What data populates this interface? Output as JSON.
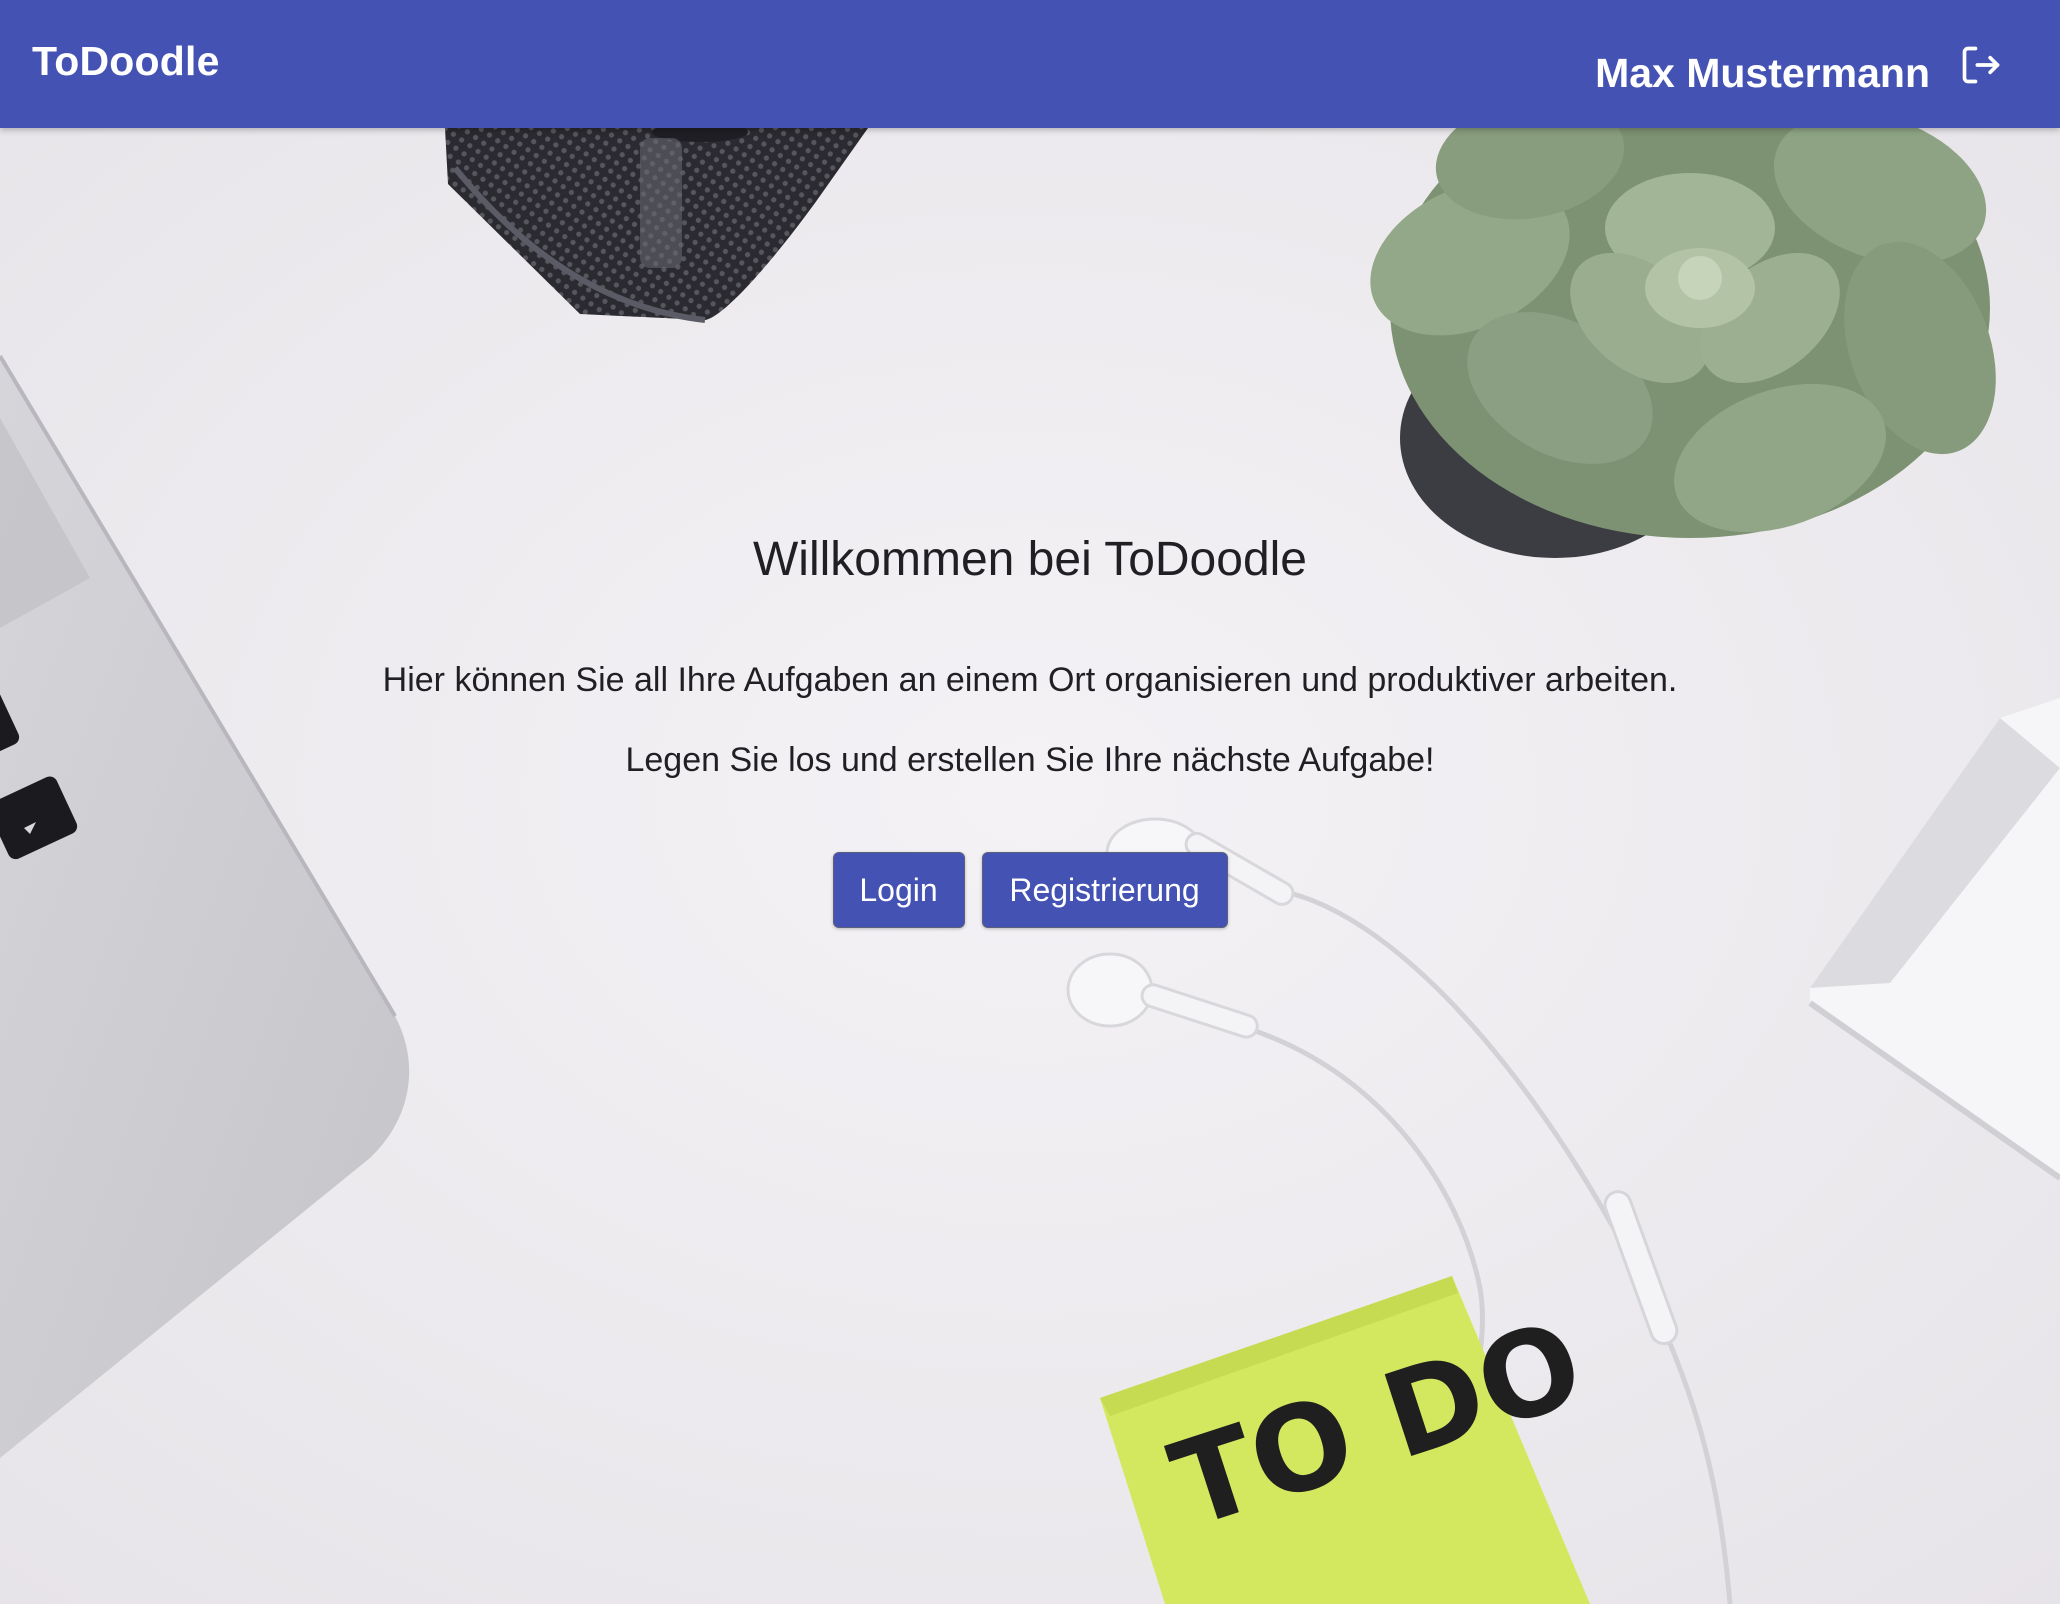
{
  "app": {
    "brand": "ToDoodle"
  },
  "header": {
    "user_name": "Max Mustermann",
    "logout_icon": "logout-icon"
  },
  "welcome": {
    "title": "Willkommen bei ToDoodle",
    "line1": "Hier können Sie all Ihre Aufgaben an einem Ort organisieren und produktiver arbeiten.",
    "line2": "Legen Sie los und erstellen Sie Ihre nächste Aufgabe!"
  },
  "actions": {
    "login_label": "Login",
    "register_label": "Registrierung"
  },
  "background": {
    "sticky_note_text": "TO DO"
  },
  "colors": {
    "primary": "#4352b3",
    "background": "#efedf0",
    "note": "#d4e85f",
    "plant": "#8aa07d"
  }
}
